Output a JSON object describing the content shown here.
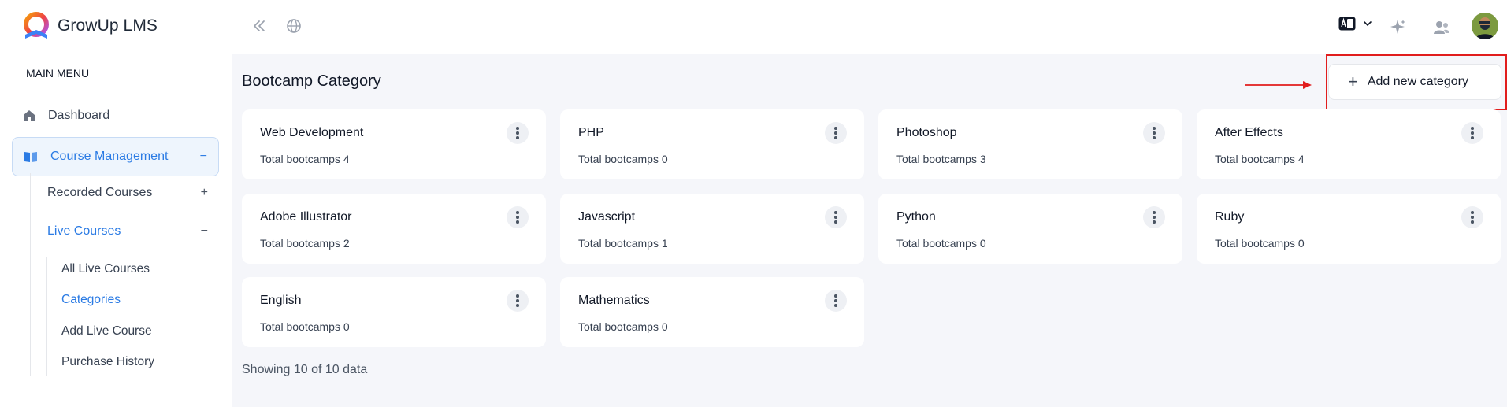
{
  "app": {
    "name": "GrowUp LMS"
  },
  "sidebar": {
    "menu_label": "MAIN MENU",
    "dashboard": {
      "label": "Dashboard",
      "icon": "home-icon"
    },
    "course_management": {
      "label": "Course Management",
      "icon": "book-open-icon",
      "toggle": "−"
    },
    "recorded_courses": {
      "label": "Recorded Courses",
      "toggle": "+"
    },
    "live_courses": {
      "label": "Live Courses",
      "toggle": "−"
    },
    "live_items": [
      {
        "label": "All Live Courses"
      },
      {
        "label": "Categories",
        "active": true
      },
      {
        "label": "Add Live Course"
      },
      {
        "label": "Purchase History"
      }
    ]
  },
  "topbar": {
    "icons": [
      "collapse-icon",
      "globe-icon",
      "language-icon",
      "chevron-down-icon",
      "sparkle-icon",
      "users-icon",
      "avatar"
    ]
  },
  "page": {
    "title": "Bootcamp Category",
    "add_button_label": "Add new category",
    "footer_info": "Showing 10 of 10 data"
  },
  "categories": [
    {
      "name": "Web Development",
      "count_text": "Total bootcamps 4"
    },
    {
      "name": "PHP",
      "count_text": "Total bootcamps 0"
    },
    {
      "name": "Photoshop",
      "count_text": "Total bootcamps 3"
    },
    {
      "name": "After Effects",
      "count_text": "Total bootcamps 4"
    },
    {
      "name": "Adobe Illustrator",
      "count_text": "Total bootcamps 2"
    },
    {
      "name": "Javascript",
      "count_text": "Total bootcamps 1"
    },
    {
      "name": "Python",
      "count_text": "Total bootcamps 0"
    },
    {
      "name": "Ruby",
      "count_text": "Total bootcamps 0"
    },
    {
      "name": "English",
      "count_text": "Total bootcamps 0"
    },
    {
      "name": "Mathematics",
      "count_text": "Total bootcamps 0"
    }
  ],
  "colors": {
    "accent": "#2b7be4",
    "highlight": "#e11d1d",
    "background": "#f5f6fa"
  }
}
